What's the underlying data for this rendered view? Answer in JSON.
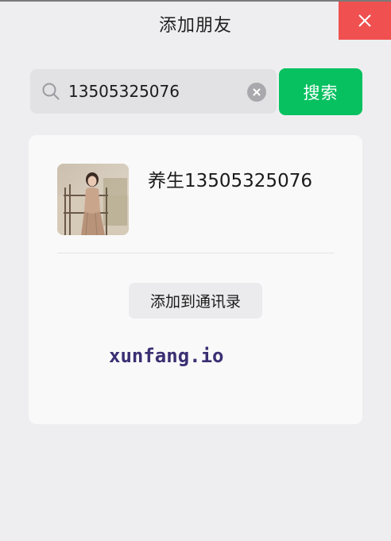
{
  "window": {
    "title": "添加朋友",
    "close_icon": "close-icon"
  },
  "search": {
    "value": "13505325076",
    "search_icon": "search-icon",
    "clear_icon": "clear-icon",
    "button_label": "搜索"
  },
  "result": {
    "name": "养生13505325076",
    "avatar": "avatar-photo",
    "add_button_label": "添加到通讯录"
  },
  "watermark": {
    "text": "xunfang.io"
  },
  "colors": {
    "accent_green": "#07c160",
    "close_red": "#f05050",
    "background": "#eeeef0",
    "card": "#f9f9f9"
  }
}
